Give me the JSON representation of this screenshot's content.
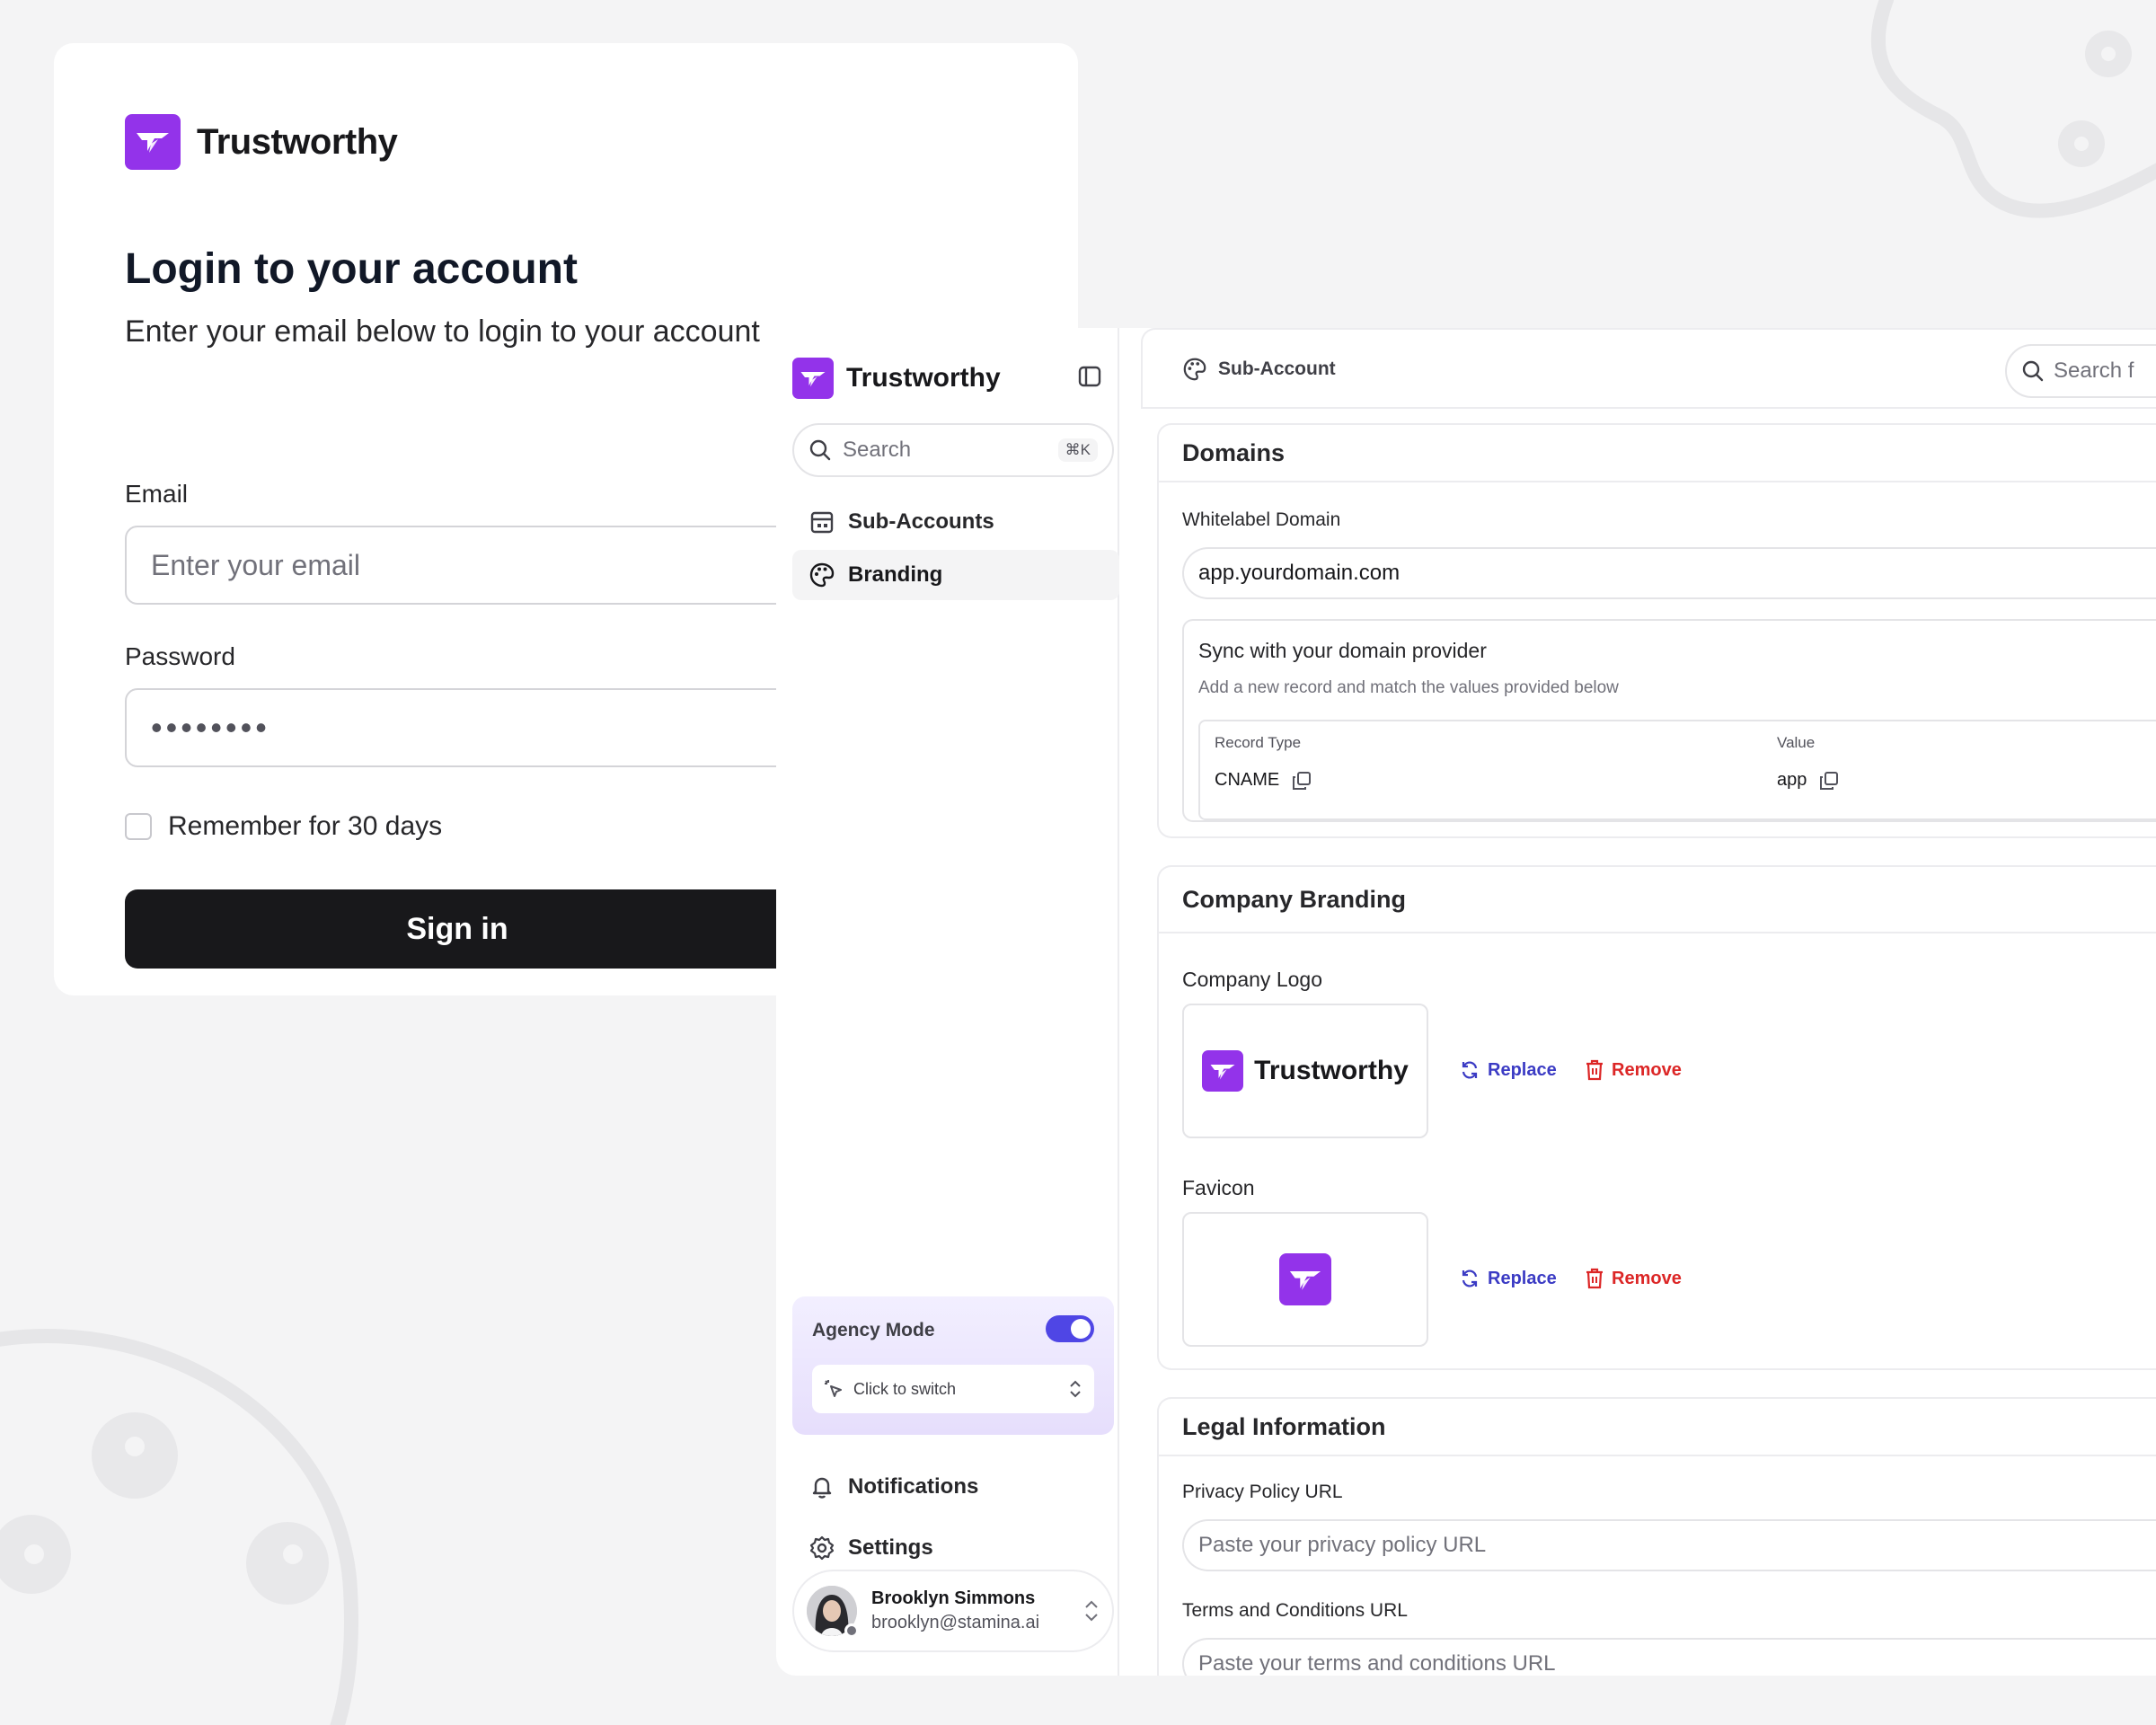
{
  "brand": {
    "name": "Trustworthy",
    "accent": "#9333ea",
    "toggle_color": "#4f46e5"
  },
  "login": {
    "title": "Login to your account",
    "subtitle": "Enter your email below to login to your account",
    "email_label": "Email",
    "email_placeholder": "Enter your email",
    "password_label": "Password",
    "password_value": "••••••••",
    "remember_label": "Remember for 30 days",
    "signin_label": "Sign in"
  },
  "sidebar": {
    "search_placeholder": "Search",
    "search_shortcut": "⌘K",
    "nav": [
      {
        "label": "Sub-Accounts",
        "icon": "building-icon",
        "active": false
      },
      {
        "label": "Branding",
        "icon": "palette-icon",
        "active": true
      }
    ],
    "agency_mode": {
      "label": "Agency Mode",
      "enabled": true,
      "switch_label": "Click to switch"
    },
    "bottom": [
      {
        "label": "Notifications",
        "icon": "bell-icon"
      },
      {
        "label": "Settings",
        "icon": "gear-icon"
      }
    ],
    "user": {
      "name": "Brooklyn Simmons",
      "email": "brooklyn@stamina.ai"
    }
  },
  "topbar": {
    "breadcrumb": "Sub-Account",
    "search_placeholder": "Search f"
  },
  "domains": {
    "title": "Domains",
    "whitelabel_label": "Whitelabel Domain",
    "whitelabel_value": "app.yourdomain.com",
    "sync_title": "Sync with your domain provider",
    "sync_desc": "Add a new record and match the values provided below",
    "record_type_header": "Record Type",
    "value_header": "Value",
    "record_type": "CNAME",
    "record_value": "app"
  },
  "branding": {
    "title": "Company Branding",
    "logo_label": "Company Logo",
    "favicon_label": "Favicon",
    "replace_label": "Replace",
    "remove_label": "Remove"
  },
  "legal": {
    "title": "Legal Information",
    "privacy_label": "Privacy Policy URL",
    "privacy_placeholder": "Paste your privacy policy URL",
    "terms_label": "Terms and Conditions URL",
    "terms_placeholder": "Paste your terms and conditions URL"
  }
}
